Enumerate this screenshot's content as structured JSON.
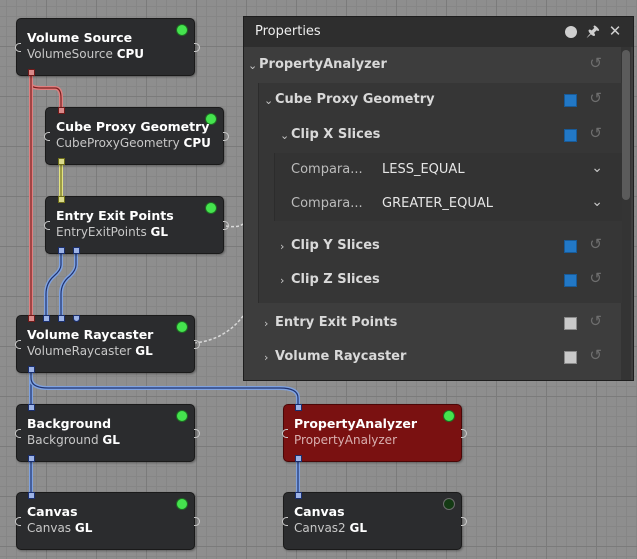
{
  "nodes": {
    "volume_source": {
      "title": "Volume Source",
      "class_name": "VolumeSource",
      "tag": "CPU"
    },
    "cube_proxy": {
      "title": "Cube Proxy Geometry",
      "class_name": "CubeProxyGeometry",
      "tag": "CPU"
    },
    "entry_exit": {
      "title": "Entry Exit Points",
      "class_name": "EntryExitPoints",
      "tag": "GL"
    },
    "raycaster": {
      "title": "Volume Raycaster",
      "class_name": "VolumeRaycaster",
      "tag": "GL"
    },
    "background": {
      "title": "Background",
      "class_name": "Background",
      "tag": "GL"
    },
    "canvas": {
      "title": "Canvas",
      "class_name": "Canvas",
      "tag": "GL"
    },
    "property_analyzer": {
      "title": "PropertyAnalyzer",
      "class_name": "PropertyAnalyzer",
      "tag": ""
    },
    "canvas2": {
      "title": "Canvas",
      "class_name": "Canvas2",
      "tag": "GL"
    }
  },
  "panel": {
    "title": "Properties",
    "rows": {
      "root": "PropertyAnalyzer",
      "cube_proxy": "Cube Proxy Geometry",
      "clip_x": "Clip X Slices",
      "comp1_label": "Compara...",
      "comp1_value": "LESS_EQUAL",
      "comp2_label": "Compara...",
      "comp2_value": "GREATER_EQUAL",
      "clip_y": "Clip Y Slices",
      "clip_z": "Clip Z Slices",
      "entry_exit": "Entry Exit Points",
      "raycaster": "Volume Raycaster"
    }
  },
  "icons": {
    "collapse": "chevron-down-icon",
    "expand": "chevron-right-icon",
    "reset": "reset-icon",
    "pin": "pin-icon",
    "close": "close-icon",
    "float": "float-dot-icon"
  },
  "colors": {
    "canvas_bg": "#8e8e8e",
    "node_bg": "#2b2c2e",
    "selected_node_bg": "#7a1111",
    "volume_port": "#d98a8a",
    "mesh_port": "#dada8a",
    "image_port": "#9db3e6",
    "checkbox_blue": "#2278c6",
    "status_on": "#45e34e",
    "status_off": "#143a14"
  }
}
